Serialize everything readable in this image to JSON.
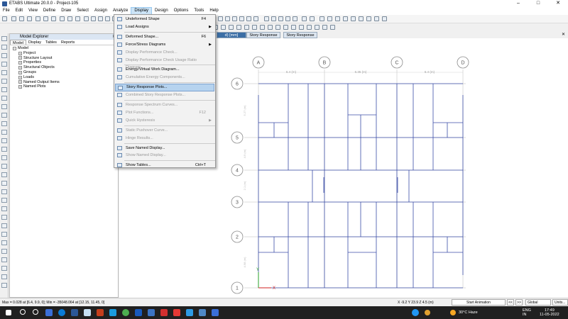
{
  "window": {
    "title": "ETABS Ultimate 20.0.0 - Project-105",
    "minimize": "–",
    "maximize": "□",
    "close": "✕"
  },
  "menubar": [
    "File",
    "Edit",
    "View",
    "Define",
    "Draw",
    "Select",
    "Assign",
    "Analyze",
    "Display",
    "Design",
    "Options",
    "Tools",
    "Help"
  ],
  "active_menu": "Display",
  "display_menu": [
    {
      "label": "Undeformed Shape",
      "shortcut": "F4",
      "enabled": true
    },
    {
      "label": "Load Assigns",
      "submenu": true,
      "enabled": true
    },
    {
      "sep": true
    },
    {
      "label": "Deformed Shape...",
      "shortcut": "F6",
      "enabled": true
    },
    {
      "label": "Force/Stress Diagrams",
      "submenu": true,
      "enabled": true
    },
    {
      "label": "Display Performance Check...",
      "enabled": false
    },
    {
      "label": "Display Performance Check Usage Ratio Diagram...",
      "enabled": false
    },
    {
      "sep": true
    },
    {
      "label": "Energy/Virtual Work Diagram...",
      "enabled": true
    },
    {
      "label": "Cumulative Energy Components...",
      "enabled": false
    },
    {
      "sep": true
    },
    {
      "label": "Story Response Plots...",
      "enabled": true,
      "highlighted": true
    },
    {
      "label": "Combined Story Response Plots...",
      "enabled": false
    },
    {
      "sep": true
    },
    {
      "label": "Response Spectrum Curves...",
      "enabled": false
    },
    {
      "label": "Plot Functions...",
      "shortcut": "F12",
      "enabled": false
    },
    {
      "label": "Quick Hysteresis",
      "submenu": true,
      "enabled": false
    },
    {
      "sep": true
    },
    {
      "label": "Static Pushover Curve...",
      "enabled": false
    },
    {
      "label": "Hinge Results...",
      "enabled": false
    },
    {
      "sep": true
    },
    {
      "label": "Save Named Display...",
      "enabled": true
    },
    {
      "label": "Show Named Display...",
      "enabled": false
    },
    {
      "sep": true
    },
    {
      "label": "Show Tables...",
      "shortcut": "Ctrl+T",
      "enabled": true
    }
  ],
  "explorer": {
    "title": "Model Explorer",
    "close": "✕",
    "tabs": [
      "Model",
      "Display",
      "Tables",
      "Reports"
    ],
    "active_tab": "Model",
    "root": "Model",
    "items": [
      "Project",
      "Structure Layout",
      "Properties",
      "Structural Objects",
      "Groups",
      "Loads",
      "Named Output Items",
      "Named Plots"
    ]
  },
  "view_tabs": [
    {
      "label": "d) [mm]",
      "active": true
    },
    {
      "label": "Story Response",
      "active": false
    },
    {
      "label": "Story Response",
      "active": false
    }
  ],
  "view_close": "✕",
  "grid": {
    "columns": [
      "A",
      "B",
      "C",
      "D"
    ],
    "rows": [
      "6",
      "5",
      "4",
      "3",
      "2",
      "1"
    ],
    "spacing_top": [
      "6.4 (m)",
      "6.35 (m)",
      "6.4 (m)"
    ],
    "left_dims": [
      "5.27 (m)",
      "4.9 (m)",
      "2.1 (m)",
      "4.98 (m)"
    ],
    "axis_x": "X",
    "axis_y": "Y"
  },
  "status": {
    "left": "Max = 0.028 at [6.4, 9.9, 0]; Min = -35048.064 at [12.15, 11.45, 0]",
    "coords": "X -9.2  Y 23.9  Z 4.5 (m)",
    "animation": "Start Animation",
    "prev": "<<",
    "next": ">>",
    "system": "Global",
    "units": "Units..."
  },
  "taskbar": {
    "weather": "30°C  Haze",
    "lang": "ENG",
    "region": "IN",
    "time": "17:49",
    "date": "11-05-2022"
  },
  "colors": {
    "grid_line": "#3b4ea8",
    "grid_bubble": "#8a8a8a",
    "menu_highlight": "#b6d3ef",
    "active_tab": "#3b6ea5",
    "taskbar": "#202020"
  }
}
